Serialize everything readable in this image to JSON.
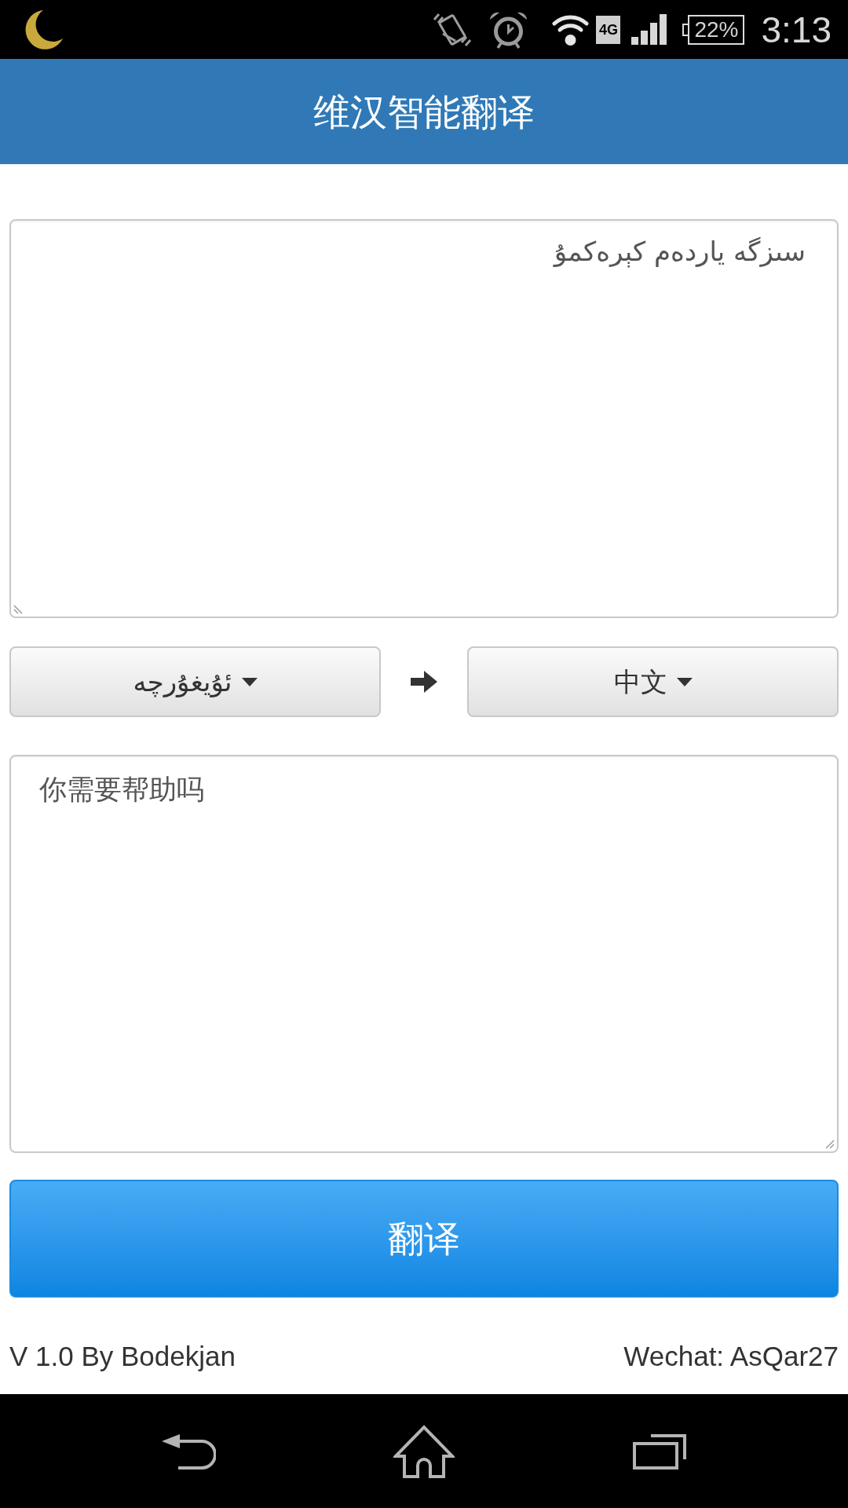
{
  "status_bar": {
    "network": "4G",
    "battery": "22%",
    "time": "3:13"
  },
  "header": {
    "title": "维汉智能翻译"
  },
  "source_text": {
    "value": "سىزگە ياردەم كېرەكمۇ"
  },
  "language_selectors": [
    {
      "label": "ئۇيغۇرچە"
    },
    {
      "label": "中文"
    }
  ],
  "target_text": {
    "value": "你需要帮助吗"
  },
  "translate_button": {
    "label": "翻译"
  },
  "footer": {
    "version": "V 1.0 By Bodekjan",
    "contact": "Wechat: AsQar27"
  }
}
